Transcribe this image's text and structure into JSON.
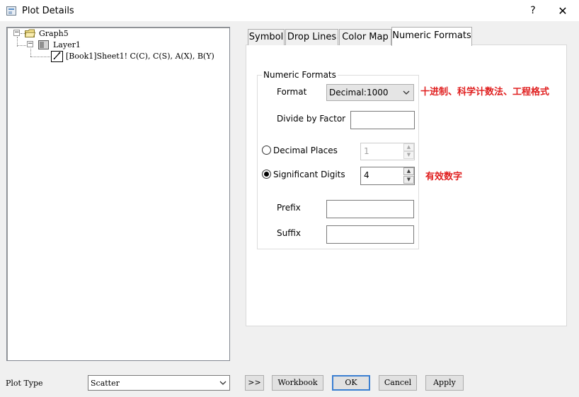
{
  "window": {
    "title": "Plot Details",
    "help_label": "?",
    "close_label": "✕"
  },
  "tree": {
    "graph": "Graph5",
    "layer": "Layer1",
    "dataset": "[Book1]Sheet1! C(C), C(S), A(X), B(Y)",
    "expand_symbol": "−"
  },
  "tabs": [
    {
      "label": "Symbol"
    },
    {
      "label": "Drop Lines"
    },
    {
      "label": "Color Map"
    },
    {
      "label": "Numeric Formats",
      "active": true
    }
  ],
  "numeric_formats": {
    "group_label": "Numeric Formats",
    "format_label": "Format",
    "format_value": "Decimal:1000",
    "divide_label": "Divide by Factor",
    "divide_value": "",
    "decimal_places_label": "Decimal Places",
    "decimal_places_value": "1",
    "decimal_places_selected": false,
    "significant_digits_label": "Significant Digits",
    "significant_digits_value": "4",
    "significant_digits_selected": true,
    "prefix_label": "Prefix",
    "prefix_value": "",
    "suffix_label": "Suffix",
    "suffix_value": ""
  },
  "annotations": {
    "format_note": "十进制、科学计数法、工程格式",
    "digits_note": "有效数字",
    "color": "#e02020"
  },
  "bottom": {
    "plot_type_label": "Plot Type",
    "plot_type_value": "Scatter",
    "expand_button": ">>",
    "workbook_button": "Workbook",
    "ok_button": "OK",
    "cancel_button": "Cancel",
    "apply_button": "Apply"
  },
  "icons": {
    "app": "plot-details-icon",
    "graph": "folder-icon",
    "layer": "layer-icon",
    "dataset": "dataplot-icon",
    "combo": "chevron-down-icon",
    "spin_up": "spin-up-icon",
    "spin_down": "spin-down-icon"
  }
}
